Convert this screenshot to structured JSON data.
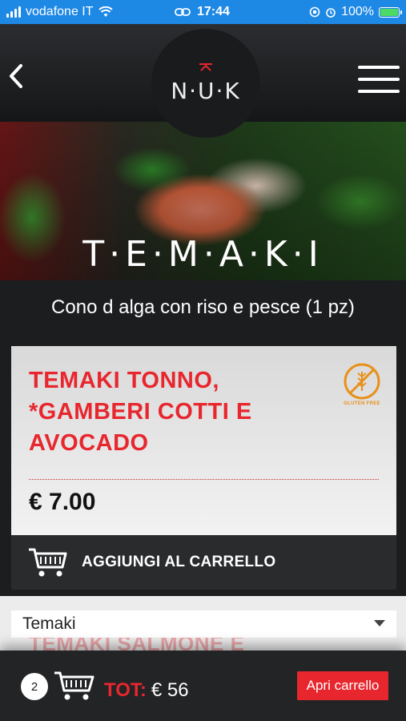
{
  "status_bar": {
    "carrier": "vodafone IT",
    "time": "17:44",
    "battery": "100%"
  },
  "header": {
    "logo_text": "N·U·K"
  },
  "hero": {
    "title": "T·E·M·A·K·I"
  },
  "category_description": "Cono d alga con riso e pesce (1 pz)",
  "product": {
    "name": "TEMAKI TONNO, *GAMBERI COTTI E AVOCADO",
    "allergen_label": "GLUTEN FREE",
    "price": "€ 7.00",
    "add_label": "AGGIUNGI AL CARRELLO"
  },
  "category_select": {
    "value": "Temaki",
    "ghost_item": "TEMAKI SALMONE E"
  },
  "cart_bar": {
    "count": "2",
    "total_label": "TOT:",
    "total_value": "€ 56",
    "open_label": "Apri carrello"
  },
  "colors": {
    "accent": "#e8262e",
    "status_bar": "#1e88e5",
    "header": "#1c1d1f"
  }
}
